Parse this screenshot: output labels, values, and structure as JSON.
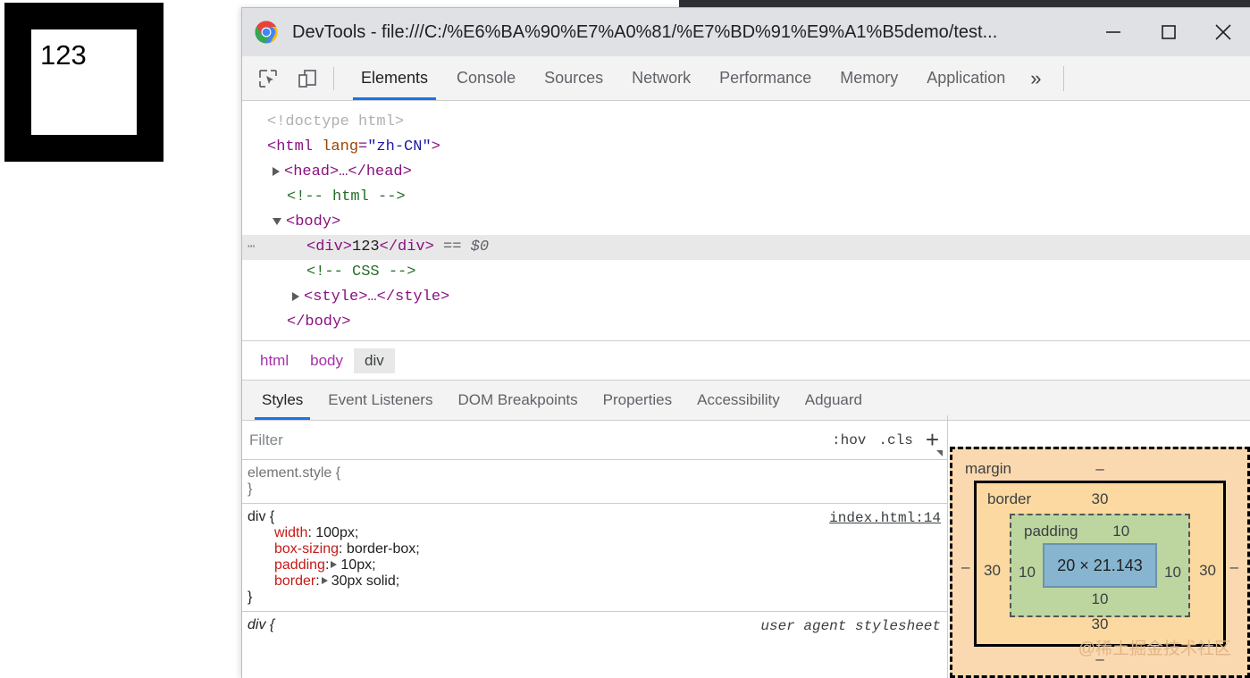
{
  "window": {
    "title": "DevTools - file:///C:/%E6%BA%90%E7%A0%81/%E7%BD%91%E9%A1%B5demo/test...",
    "logo_icon": "chrome-logo-icon",
    "minimize": "—",
    "maximize": "□",
    "close": "✕"
  },
  "toolbar": {
    "inspect_icon": "inspect-element-icon",
    "device_icon": "device-toolbar-icon",
    "tabs": [
      {
        "label": "Elements",
        "active": true
      },
      {
        "label": "Console",
        "active": false
      },
      {
        "label": "Sources",
        "active": false
      },
      {
        "label": "Network",
        "active": false
      },
      {
        "label": "Performance",
        "active": false
      },
      {
        "label": "Memory",
        "active": false
      },
      {
        "label": "Application",
        "active": false
      }
    ],
    "more_label": "»"
  },
  "page_render": {
    "div_text": "123"
  },
  "dom": {
    "rows": [
      {
        "id": "doctype",
        "text": "<!doctype html>"
      },
      {
        "id": "html-open",
        "tag_open": "<html",
        "attr": "lang",
        "eq": "=",
        "value": "\"zh-CN\"",
        "tag_close": ">"
      },
      {
        "id": "head",
        "text": "<head>…</head>"
      },
      {
        "id": "comment-html",
        "text": "<!-- html -->"
      },
      {
        "id": "body-open",
        "text": "<body>"
      },
      {
        "id": "div-selected",
        "open": "<div>",
        "content": "123",
        "close": "</div>",
        "ref": "== $0"
      },
      {
        "id": "comment-css",
        "text": "<!-- CSS -->"
      },
      {
        "id": "style",
        "text": "<style>…</style>"
      },
      {
        "id": "body-close",
        "text": "</body>"
      }
    ]
  },
  "breadcrumb": {
    "items": [
      {
        "label": "html",
        "active": false
      },
      {
        "label": "body",
        "active": false
      },
      {
        "label": "div",
        "active": true
      }
    ]
  },
  "styles_panel": {
    "tabs": [
      {
        "label": "Styles",
        "active": true
      },
      {
        "label": "Event Listeners",
        "active": false
      },
      {
        "label": "DOM Breakpoints",
        "active": false
      },
      {
        "label": "Properties",
        "active": false
      },
      {
        "label": "Accessibility",
        "active": false
      },
      {
        "label": "Adguard",
        "active": false
      }
    ],
    "filter": {
      "placeholder": "Filter",
      "value": "",
      "hov_label": ":hov",
      "cls_label": ".cls",
      "new_rule_label": "+"
    },
    "rules": [
      {
        "selector": "element.style {",
        "origin": "",
        "close": "}",
        "declarations": []
      },
      {
        "selector": "div {",
        "origin": "index.html:14",
        "close": "}",
        "declarations": [
          {
            "name": "width",
            "value": "100px;",
            "expandable": false
          },
          {
            "name": "box-sizing",
            "value": "border-box;",
            "expandable": false
          },
          {
            "name": "padding",
            "value": "10px;",
            "expandable": true
          },
          {
            "name": "border",
            "value": "30px solid;",
            "expandable": true
          }
        ]
      },
      {
        "selector": "div {",
        "origin": "user agent stylesheet",
        "close": "",
        "declarations": []
      }
    ]
  },
  "box_model": {
    "margin_label": "margin",
    "border_label": "border",
    "padding_label": "padding",
    "content_size": "20 × 21.143",
    "margin": {
      "top": "–",
      "right": "–",
      "bottom": "–",
      "left": "–"
    },
    "border": {
      "top": "30",
      "right": "30",
      "bottom": "30",
      "left": "30"
    },
    "padding": {
      "top": "10",
      "right": "10",
      "bottom": "10",
      "left": "10"
    },
    "watermark": "@稀土掘金技术社区",
    "colors": {
      "margin": "#fbd9b0",
      "border": "#fcd9a0",
      "padding": "#bdd6a0",
      "content": "#87b5cf"
    }
  }
}
